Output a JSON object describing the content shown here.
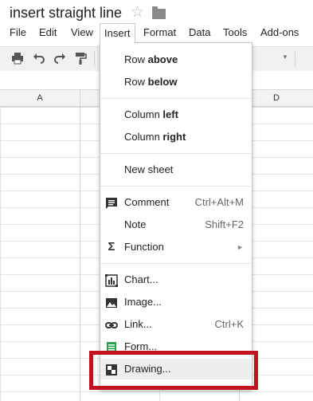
{
  "document": {
    "title": "insert straight line"
  },
  "menubar": {
    "items": [
      "File",
      "Edit",
      "View",
      "Insert",
      "Format",
      "Data",
      "Tools",
      "Add-ons"
    ]
  },
  "columns": [
    "A",
    "D"
  ],
  "insert_menu": {
    "row_above": {
      "prefix": "Row ",
      "bold": "above"
    },
    "row_below": {
      "prefix": "Row ",
      "bold": "below"
    },
    "column_left": {
      "prefix": "Column ",
      "bold": "left"
    },
    "column_right": {
      "prefix": "Column ",
      "bold": "right"
    },
    "new_sheet": "New sheet",
    "comment": {
      "label": "Comment",
      "shortcut": "Ctrl+Alt+M"
    },
    "note": {
      "label": "Note",
      "shortcut": "Shift+F2"
    },
    "function": {
      "label": "Function"
    },
    "chart": "Chart...",
    "image": "Image...",
    "link": {
      "label": "Link...",
      "shortcut": "Ctrl+K"
    },
    "form": "Form...",
    "drawing": "Drawing..."
  },
  "highlight": {
    "color": "#c1121f",
    "target": "Drawing..."
  }
}
